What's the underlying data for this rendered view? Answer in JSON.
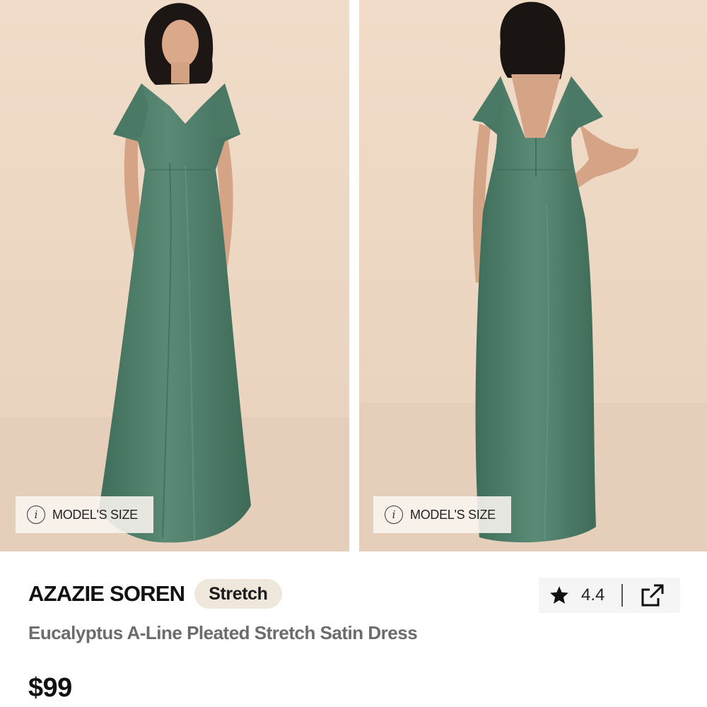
{
  "gallery": {
    "images": [
      {
        "view": "front",
        "model_size_label": "MODEL'S SIZE"
      },
      {
        "view": "back",
        "model_size_label": "MODEL'S SIZE"
      }
    ],
    "info_icon": "info-icon"
  },
  "product": {
    "brand": "AZAZIE SOREN",
    "badge": "Stretch",
    "name": "Eucalyptus A-Line Pleated Stretch Satin Dress",
    "price": "$99"
  },
  "rating": {
    "value": "4.4",
    "icon": "star-icon"
  },
  "actions": {
    "share_icon": "share-external-icon"
  },
  "colors": {
    "dress": "#4f7d6a",
    "background": "#ecd9c6",
    "badge_bg": "#efe7db",
    "product_name": "#6c6c6c"
  }
}
